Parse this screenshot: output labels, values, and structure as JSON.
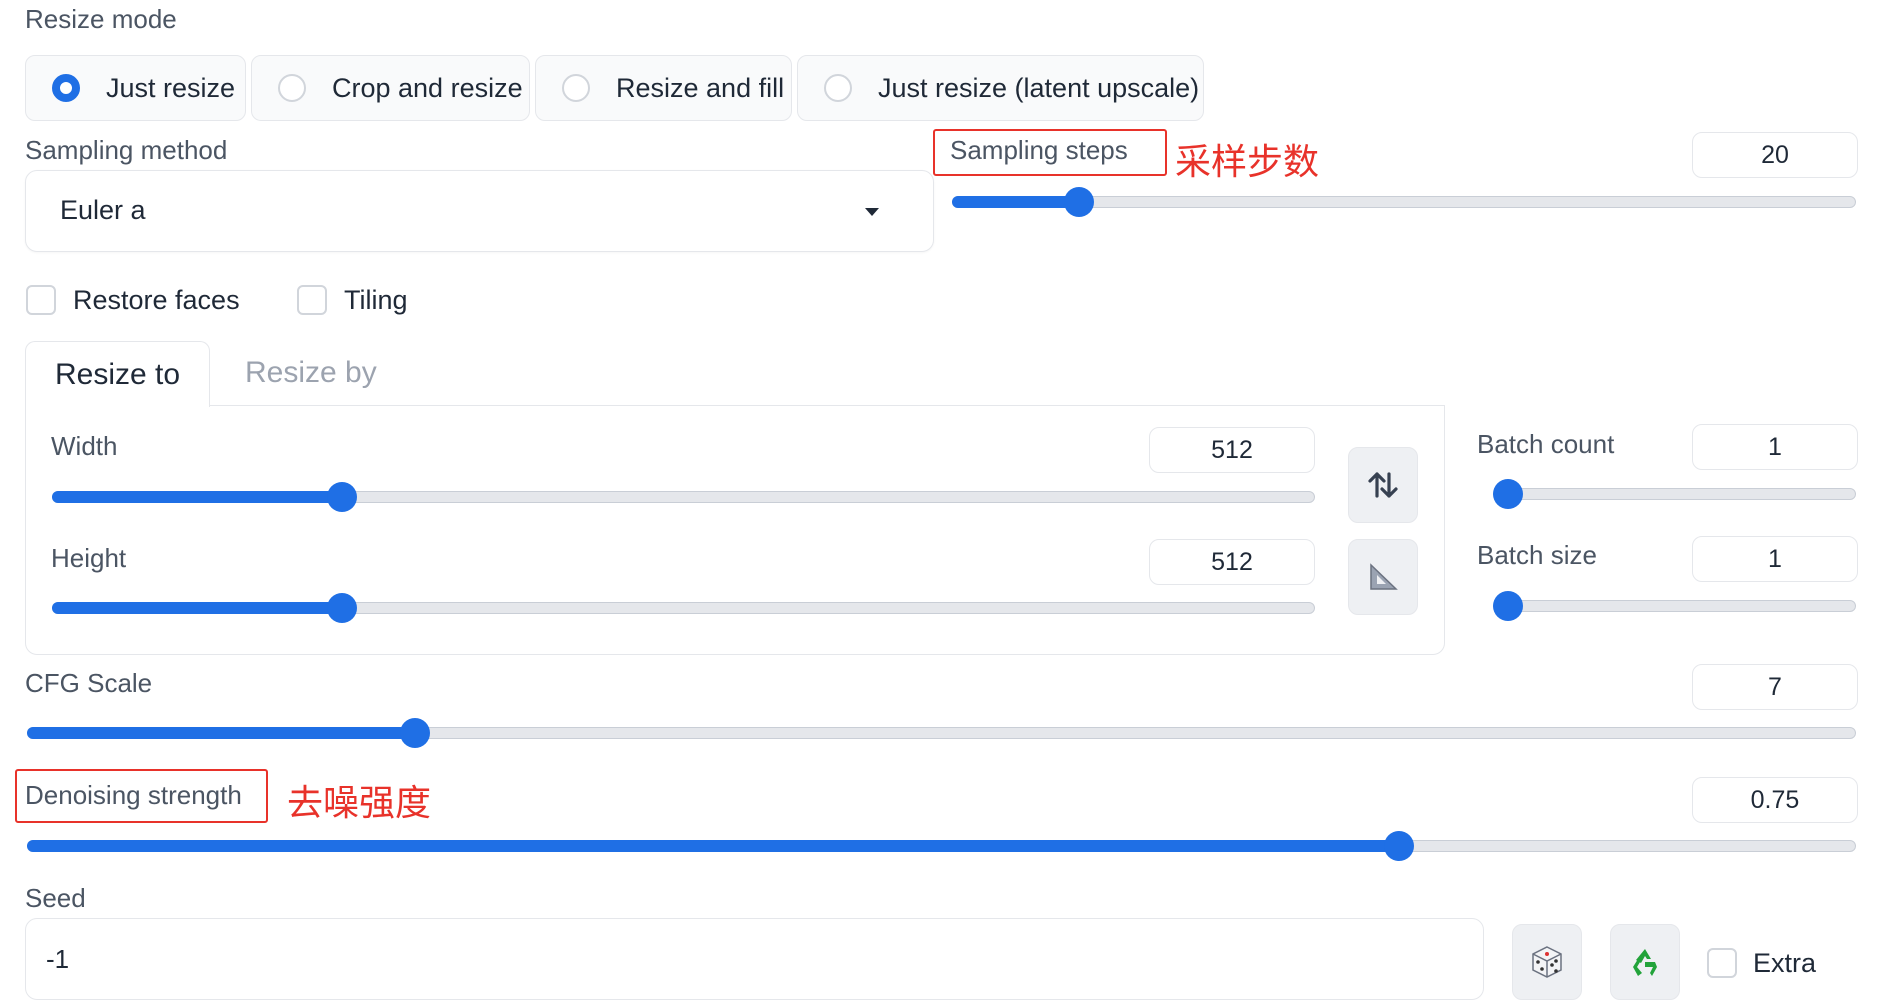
{
  "resize_mode": {
    "label": "Resize mode",
    "options": [
      "Just resize",
      "Crop and resize",
      "Resize and fill",
      "Just resize (latent upscale)"
    ],
    "selected": "Just resize"
  },
  "sampling_method": {
    "label": "Sampling method",
    "value": "Euler a"
  },
  "sampling_steps": {
    "label": "Sampling steps",
    "annotation": "采样步数",
    "value": "20",
    "level": 0.14
  },
  "checkboxes": {
    "restore_faces": "Restore faces",
    "tiling": "Tiling"
  },
  "resize_tabs": {
    "active": "Resize to",
    "inactive": "Resize by"
  },
  "width": {
    "label": "Width",
    "value": "512",
    "level": 0.23
  },
  "height": {
    "label": "Height",
    "value": "512",
    "level": 0.23
  },
  "batch_count": {
    "label": "Batch count",
    "value": "1",
    "level": 0.0
  },
  "batch_size": {
    "label": "Batch size",
    "value": "1",
    "level": 0.0
  },
  "cfg_scale": {
    "label": "CFG Scale",
    "value": "7",
    "level": 0.212
  },
  "denoising_strength": {
    "label": "Denoising strength",
    "annotation": "去噪强度",
    "value": "0.75",
    "level": 0.75
  },
  "seed": {
    "label": "Seed",
    "value": "-1",
    "extra_label": "Extra"
  },
  "icons": {
    "swap": "swap-arrows-icon",
    "aspect": "triangle-ruler-icon",
    "dice": "dice-icon",
    "recycle": "recycle-icon",
    "dropdown": "caret-down-icon"
  },
  "colors": {
    "accent": "#1f6fe5",
    "annotation": "#e8322a"
  }
}
